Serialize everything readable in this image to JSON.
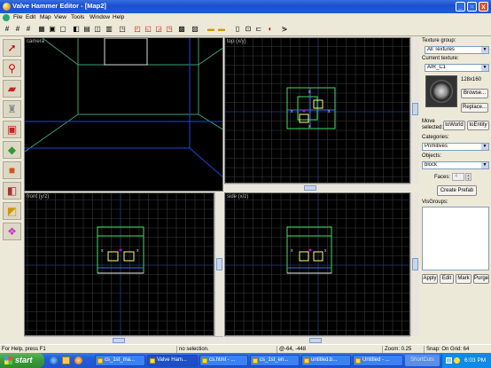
{
  "window": {
    "title": "Valve Hammer Editor - [Map2]"
  },
  "titlebar_buttons": {
    "minimize": "_",
    "restore": "▫",
    "close": "x"
  },
  "menu": [
    "File",
    "Edit",
    "Map",
    "View",
    "Tools",
    "Window",
    "Help"
  ],
  "viewports": {
    "camera": "camera",
    "top": "top (x/y)",
    "front": "front (y/z)",
    "side": "side (x/z)"
  },
  "texture_panel": {
    "group_label": "Texture group:",
    "group_value": "All Textures",
    "current_label": "Current texture:",
    "current_value": "AIR_C1",
    "size": "128x160",
    "browse": "Browse...",
    "replace": "Replace...",
    "move_selected": "Move selected:",
    "to_world": "toWorld",
    "to_entity": "toEntity"
  },
  "object_panel": {
    "categories_label": "Categories:",
    "categories_value": "Primitives",
    "objects_label": "Objects:",
    "objects_value": "block",
    "faces_label": "Faces:",
    "faces_value": "4",
    "create_prefab": "Create Prefab"
  },
  "visgroups": {
    "label": "VisGroups:",
    "apply": "Apply",
    "edit": "Edit",
    "mark": "Mark",
    "purge": "Purge"
  },
  "status": {
    "help": "For Help, press F1",
    "selection": "no selection.",
    "coords": "@-64, -448",
    "zoom": "Zoom: 0.25",
    "snap": "Snap: On Grid: 64"
  },
  "taskbar": {
    "start": "start",
    "tasks": [
      "cs_1st_ma...",
      "Valve Ham...",
      "cs.html - ...",
      "cs_1st_en...",
      "untitled.b...",
      "Untitled - ..."
    ],
    "tray_app": "ShortCuts",
    "clock": "6:03 PM"
  },
  "colors": {
    "grid": "#3a3a3a",
    "grid_axis": "#1e3aa0",
    "brush_green": "#44dd66",
    "brush_yellow": "#ffff66",
    "brush_blue": "#4466ff",
    "brush_white": "#eeeeee"
  }
}
